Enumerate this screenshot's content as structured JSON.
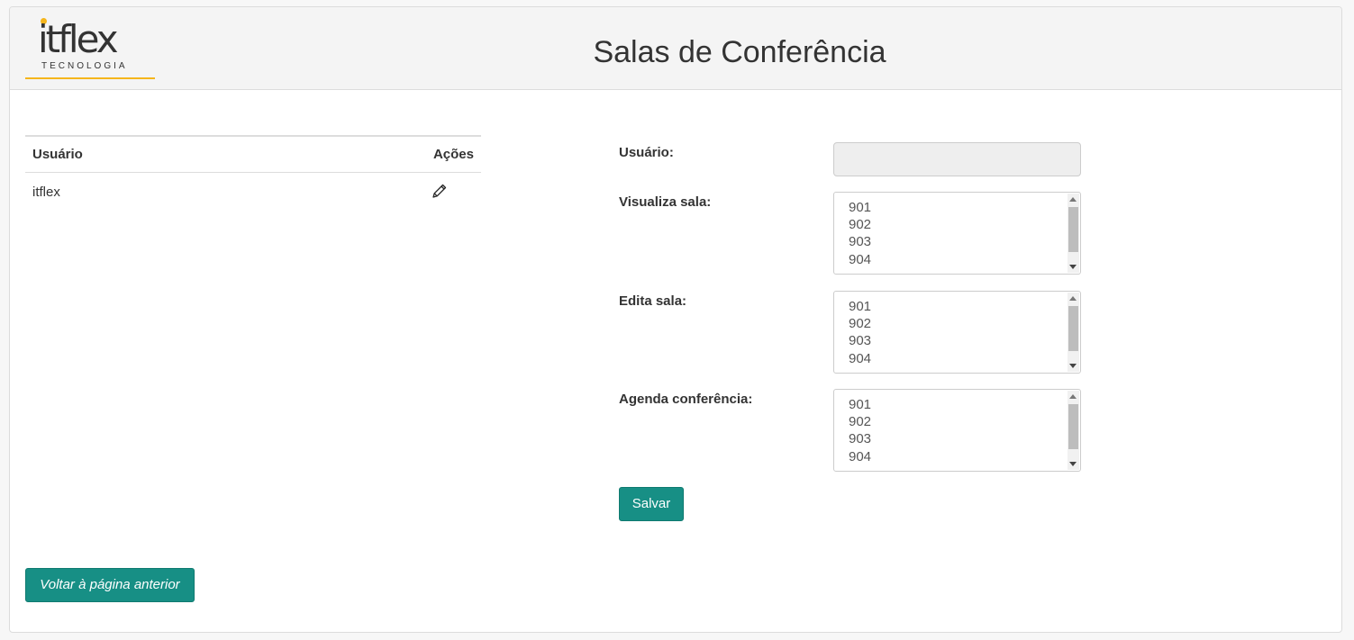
{
  "header": {
    "logo_text": "itflex",
    "logo_subtext": "TECNOLOGIA",
    "title": "Salas de Conferência"
  },
  "colors": {
    "accent": "#f5b51b",
    "button": "#178f85"
  },
  "users_table": {
    "columns": [
      "Usuário",
      "Ações"
    ],
    "rows": [
      {
        "user": "itflex",
        "action_icon": "pencil-icon"
      }
    ]
  },
  "form": {
    "user_label": "Usuário:",
    "user_value": "",
    "view_room_label": "Visualiza sala:",
    "edit_room_label": "Edita sala:",
    "schedule_label": "Agenda conferência:",
    "room_options": [
      "901",
      "902",
      "903",
      "904"
    ],
    "save_label": "Salvar"
  },
  "back_button_label": "Voltar à página anterior"
}
